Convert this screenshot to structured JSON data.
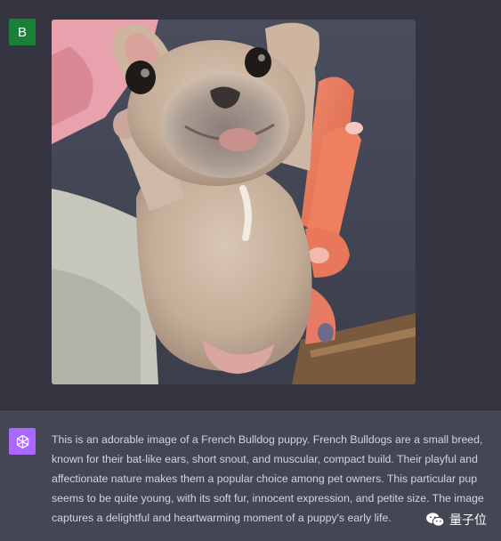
{
  "user": {
    "avatar_letter": "B",
    "avatar_color": "#1a7f37",
    "image_subject": "French Bulldog puppy held up in a hand"
  },
  "assistant": {
    "avatar_icon": "openai-logo-icon",
    "avatar_color": "#ab68ff",
    "message": "This is an adorable image of a French Bulldog puppy. French Bulldogs are a small breed, known for their bat-like ears, short snout, and muscular, compact build. Their playful and affectionate nature makes them a popular choice among pet owners. This particular pup seems to be quite young, with its soft fur, innocent expression, and petite size. The image captures a delightful and heartwarming moment of a puppy's early life."
  },
  "watermark": {
    "text": "量子位",
    "icon": "wechat-icon"
  },
  "colors": {
    "background": "#343541",
    "assistant_background": "#444654",
    "text": "#d1d5db"
  }
}
